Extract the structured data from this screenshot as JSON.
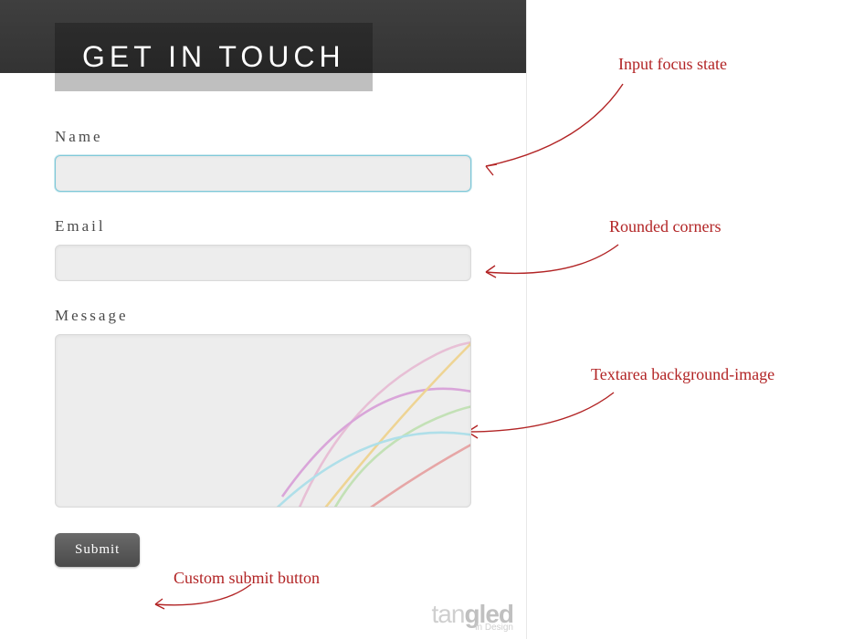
{
  "header": {
    "title": "GET IN TOUCH"
  },
  "form": {
    "name_label": "Name",
    "name_value": "",
    "email_label": "Email",
    "email_value": "",
    "message_label": "Message",
    "message_value": "",
    "submit_label": "Submit"
  },
  "annotations": {
    "focus": "Input focus state",
    "rounded": "Rounded corners",
    "textarea_bg": "Textarea background-image",
    "submit": "Custom submit button"
  },
  "brand": {
    "main_light": "tan",
    "main_bold": "gled",
    "sub": "in Design"
  },
  "colors": {
    "annotation": "#b22425",
    "input_focus_border": "#7fc8d8",
    "header_bg": "#333333",
    "button_bg": "#4a4a4a"
  }
}
